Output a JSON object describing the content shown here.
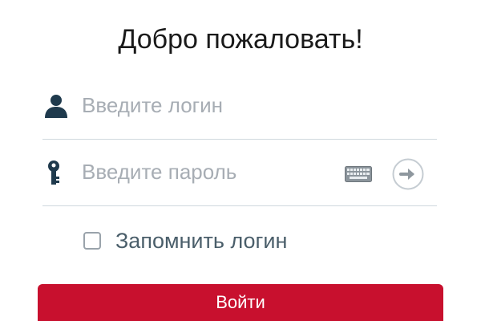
{
  "header": {
    "title": "Добро пожаловать!"
  },
  "login_field": {
    "placeholder": "Введите логин",
    "value": "",
    "icon": "user-icon"
  },
  "password_field": {
    "placeholder": "Введите пароль",
    "value": "",
    "icon": "key-icon",
    "keyboard_icon": "keyboard-icon",
    "submit_icon": "arrow-right-circle-icon"
  },
  "remember": {
    "label": "Запомнить логин",
    "checked": false
  },
  "submit": {
    "label": "Войти"
  },
  "colors": {
    "accent": "#c8102e",
    "icon": "#1f3a4d",
    "divider": "#cfd8de",
    "placeholder": "#a7adb4"
  }
}
